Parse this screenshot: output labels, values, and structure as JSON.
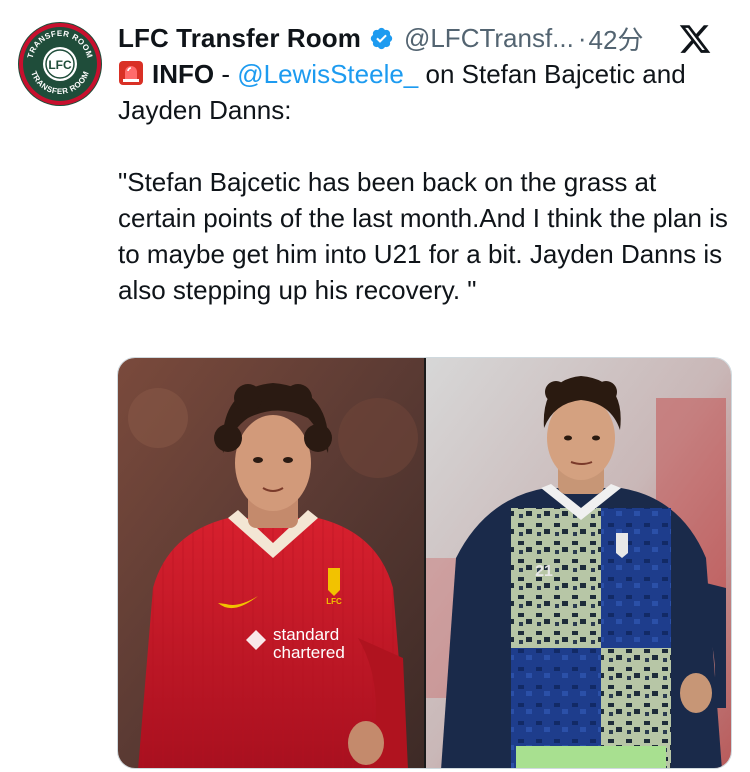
{
  "account": {
    "display_name": "LFC Transfer Room",
    "handle": "@LFCTransf...",
    "separator": "·",
    "timestamp": "42分",
    "avatar_text_top": "TRANSFER ROOM",
    "avatar_text_bottom": "TRANSFER ROOM",
    "avatar_monogram": "LFC"
  },
  "tweet": {
    "emoji_icon": "rotating-light-icon",
    "info_label": "INFO",
    "dash": " - ",
    "mention": "@LewisSteele_",
    "intro_rest": " on Stefan Bajcetic and Jayden Danns:",
    "quote": "\"Stefan Bajcetic has been back on the grass at certain points of the last month.And I think the plan is to maybe get him into U21 for a bit. Jayden Danns is also stepping up his recovery. \""
  },
  "media": {
    "left_photo": {
      "sponsor_line1": "standard",
      "sponsor_line2": "chartered",
      "crest_text": "LFC"
    },
    "right_photo": {
      "number": "21"
    }
  },
  "colors": {
    "verified": "#1d9bf0",
    "mention": "#1d9bf0",
    "muted": "#536471",
    "avatar_bg": "#1f4d3a",
    "liverpool_red": "#c8102e"
  }
}
